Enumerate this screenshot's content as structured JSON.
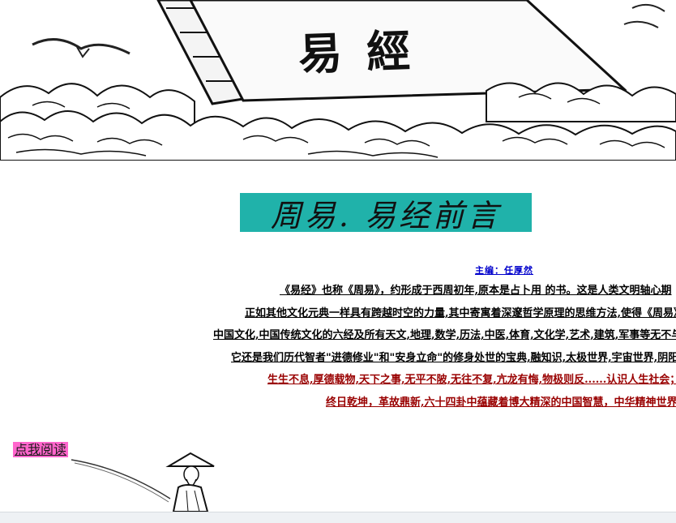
{
  "banner": {
    "book_title": "易經"
  },
  "title": "周易. 易经前言",
  "editor": "主编：任厚然",
  "lines": [
    "《易经》也称《周易》，约形成于西周初年,原本是占卜用 的书。这是人类文明轴心期",
    "正如其他文化元典一样具有跨越时空的力量,其中寄寓着深邃哲学原理的思维方法,使得《周易》",
    "中国文化,中国传统文化的六经及所有天文,地理,数学,历法,中医,体育,文化学,艺术,建筑,军事等无不与",
    "它还是我们历代智者\"进德修业\"和\"安身立命\"的修身处世的宝典,融知识,太极世界,宇宙世界,阴阳",
    "生生不息,厚德载物,天下之事,无平不陂,无往不复,亢龙有悔,物极则反......认识人生社会；谦",
    "终日乾坤，革故鼎新,六十四卦中蕴藏着博大精深的中国智慧，中华精神世界"
  ],
  "read_link": "点我阅读",
  "colors": {
    "title_bg": "#20b2aa",
    "editor_link": "#0000cc",
    "highlight_text": "#990000",
    "read_link_bg": "#ff66cc"
  }
}
